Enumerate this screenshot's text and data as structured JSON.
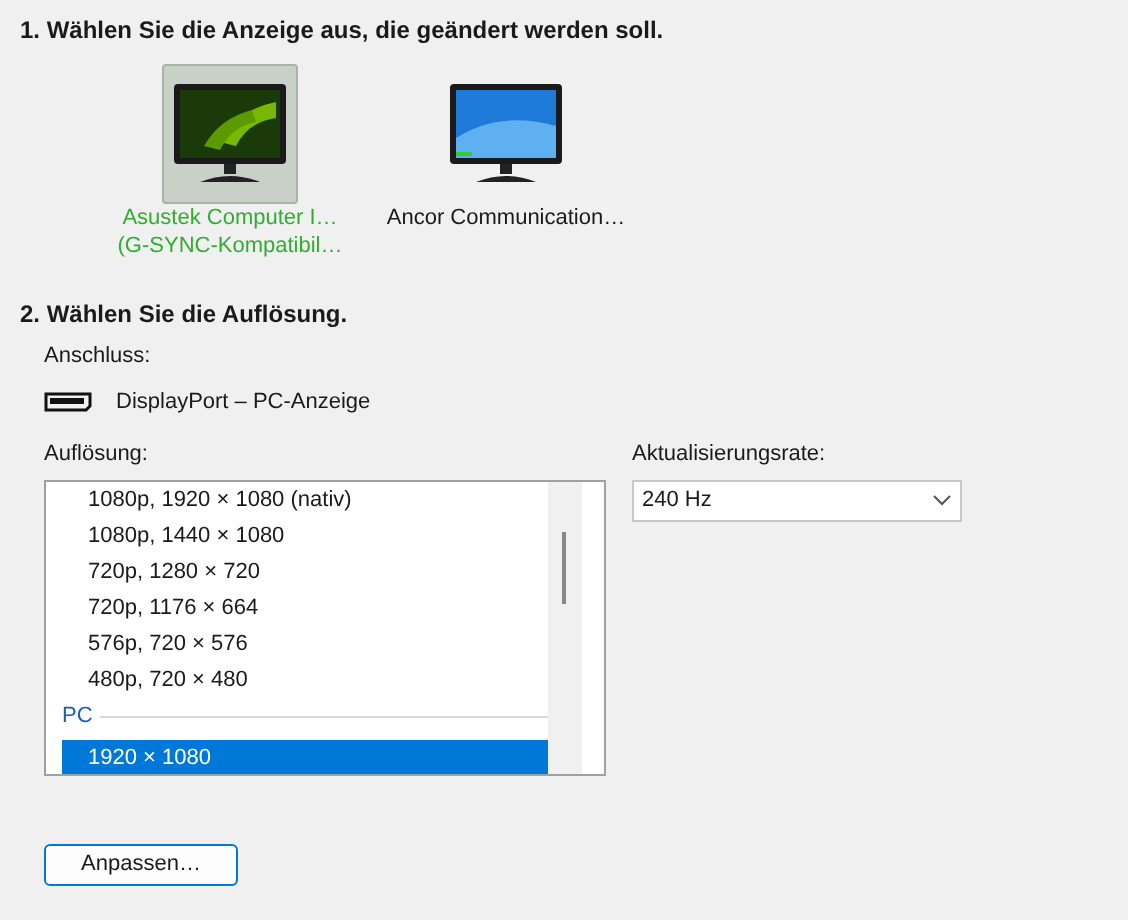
{
  "section_1": {
    "heading": "1. Wählen Sie die Anzeige aus, die geändert werden soll.",
    "displays": [
      {
        "lines": [
          "Asustek Computer I…",
          "(G-SYNC-Kompatibil…"
        ],
        "selected": true
      },
      {
        "lines": [
          "Ancor Communication…"
        ],
        "selected": false
      }
    ]
  },
  "section_2": {
    "heading": "2. Wählen Sie die Auflösung.",
    "connection_label": "Anschluss:",
    "connection": "DisplayPort – PC-Anzeige",
    "resolution_label": "Auflösung:",
    "resolutions": [
      {
        "kind": "item",
        "label": "1080p, 1920 × 1080 (nativ)",
        "selected": false
      },
      {
        "kind": "item",
        "label": "1080p, 1440 × 1080",
        "selected": false
      },
      {
        "kind": "item",
        "label": "720p, 1280 × 720",
        "selected": false
      },
      {
        "kind": "item",
        "label": "720p, 1176 × 664",
        "selected": false
      },
      {
        "kind": "item",
        "label": "576p, 720 × 576",
        "selected": false
      },
      {
        "kind": "item",
        "label": "480p, 720 × 480",
        "selected": false
      },
      {
        "kind": "group",
        "label": "PC"
      },
      {
        "kind": "item",
        "label": "1920 × 1080",
        "selected": true
      }
    ],
    "refresh_label": "Aktualisierungsrate:",
    "refresh_value": "240 Hz"
  },
  "customize_button": "Anpassen…"
}
